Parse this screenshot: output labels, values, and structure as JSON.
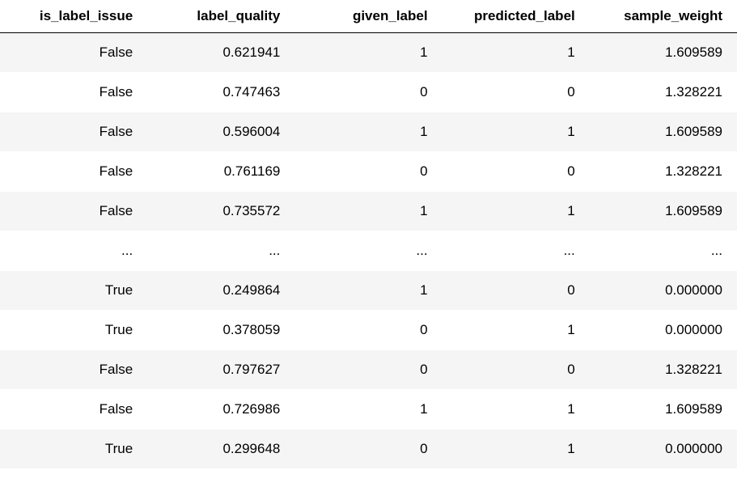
{
  "columns": [
    "is_label_issue",
    "label_quality",
    "given_label",
    "predicted_label",
    "sample_weight"
  ],
  "rows": [
    [
      "False",
      "0.621941",
      "1",
      "1",
      "1.609589"
    ],
    [
      "False",
      "0.747463",
      "0",
      "0",
      "1.328221"
    ],
    [
      "False",
      "0.596004",
      "1",
      "1",
      "1.609589"
    ],
    [
      "False",
      "0.761169",
      "0",
      "0",
      "1.328221"
    ],
    [
      "False",
      "0.735572",
      "1",
      "1",
      "1.609589"
    ],
    [
      "...",
      "...",
      "...",
      "...",
      "..."
    ],
    [
      "True",
      "0.249864",
      "1",
      "0",
      "0.000000"
    ],
    [
      "True",
      "0.378059",
      "0",
      "1",
      "0.000000"
    ],
    [
      "False",
      "0.797627",
      "0",
      "0",
      "1.328221"
    ],
    [
      "False",
      "0.726986",
      "1",
      "1",
      "1.609589"
    ],
    [
      "True",
      "0.299648",
      "0",
      "1",
      "0.000000"
    ]
  ],
  "chart_data": {
    "type": "table",
    "columns": [
      "is_label_issue",
      "label_quality",
      "given_label",
      "predicted_label",
      "sample_weight"
    ],
    "rows": [
      {
        "is_label_issue": "False",
        "label_quality": 0.621941,
        "given_label": 1,
        "predicted_label": 1,
        "sample_weight": 1.609589
      },
      {
        "is_label_issue": "False",
        "label_quality": 0.747463,
        "given_label": 0,
        "predicted_label": 0,
        "sample_weight": 1.328221
      },
      {
        "is_label_issue": "False",
        "label_quality": 0.596004,
        "given_label": 1,
        "predicted_label": 1,
        "sample_weight": 1.609589
      },
      {
        "is_label_issue": "False",
        "label_quality": 0.761169,
        "given_label": 0,
        "predicted_label": 0,
        "sample_weight": 1.328221
      },
      {
        "is_label_issue": "False",
        "label_quality": 0.735572,
        "given_label": 1,
        "predicted_label": 1,
        "sample_weight": 1.609589
      },
      {
        "ellipsis": true
      },
      {
        "is_label_issue": "True",
        "label_quality": 0.249864,
        "given_label": 1,
        "predicted_label": 0,
        "sample_weight": 0.0
      },
      {
        "is_label_issue": "True",
        "label_quality": 0.378059,
        "given_label": 0,
        "predicted_label": 1,
        "sample_weight": 0.0
      },
      {
        "is_label_issue": "False",
        "label_quality": 0.797627,
        "given_label": 0,
        "predicted_label": 0,
        "sample_weight": 1.328221
      },
      {
        "is_label_issue": "False",
        "label_quality": 0.726986,
        "given_label": 1,
        "predicted_label": 1,
        "sample_weight": 1.609589
      },
      {
        "is_label_issue": "True",
        "label_quality": 0.299648,
        "given_label": 0,
        "predicted_label": 1,
        "sample_weight": 0.0
      }
    ]
  }
}
